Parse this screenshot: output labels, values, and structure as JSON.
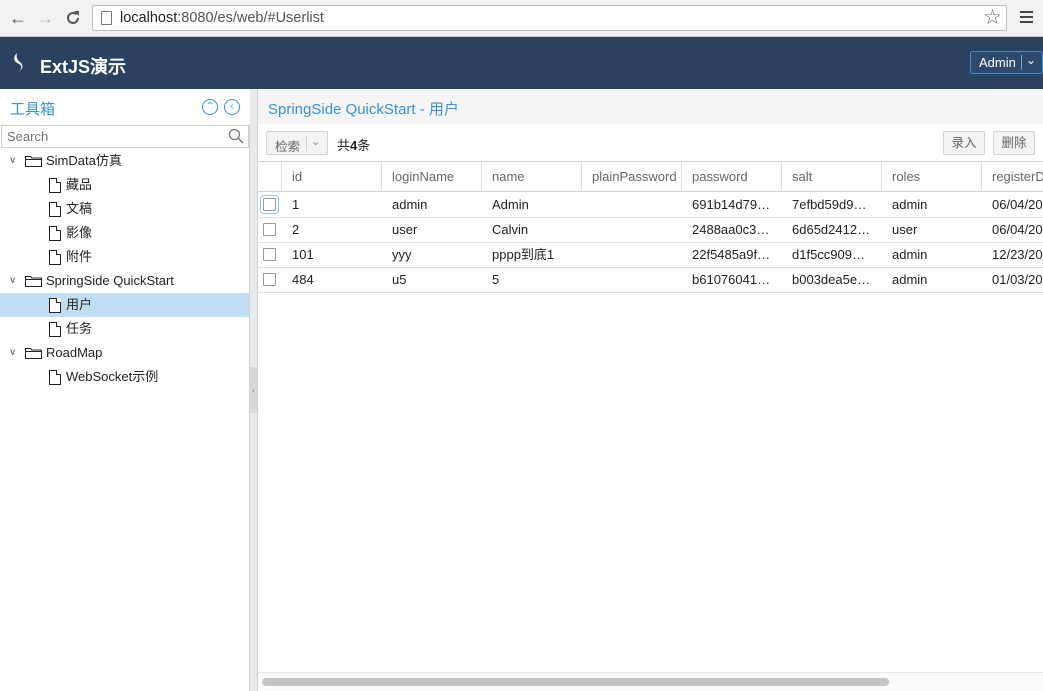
{
  "browser": {
    "url_host": "localhost",
    "url_rest": ":8080/es/web/#Userlist",
    "back_icon": "back-arrow-icon",
    "forward_icon": "forward-arrow-icon",
    "reload_icon": "reload-icon"
  },
  "app": {
    "title": "ExtJS演示",
    "user_menu_label": "Admin",
    "header_color": "#2a4260"
  },
  "west": {
    "title": "工具箱",
    "search_placeholder": "Search",
    "tree": [
      {
        "label": "SimData仿真",
        "type": "folder",
        "expanded": true,
        "children": [
          {
            "label": "藏品"
          },
          {
            "label": "文稿"
          },
          {
            "label": "影像"
          },
          {
            "label": "附件"
          }
        ]
      },
      {
        "label": "SpringSide QuickStart",
        "type": "folder",
        "expanded": true,
        "children": [
          {
            "label": "用户",
            "selected": true
          },
          {
            "label": "任务"
          }
        ]
      },
      {
        "label": "RoadMap",
        "type": "folder",
        "expanded": true,
        "children": [
          {
            "label": "WebSocket示例"
          }
        ]
      }
    ]
  },
  "center": {
    "title": "SpringSide QuickStart - 用户",
    "toolbar": {
      "search_label": "检索",
      "count_prefix": "共",
      "count_value": "4",
      "count_suffix": "条",
      "add_label": "录入",
      "delete_label": "删除"
    },
    "grid": {
      "columns": [
        "id",
        "loginName",
        "name",
        "plainPassword",
        "password",
        "salt",
        "roles",
        "registerD"
      ],
      "rows": [
        [
          "1",
          "admin",
          "Admin",
          "",
          "691b14d79…",
          "7efbd59d9…",
          "admin",
          "06/04/20"
        ],
        [
          "2",
          "user",
          "Calvin",
          "",
          "2488aa0c3…",
          "6d65d2412…",
          "user",
          "06/04/20"
        ],
        [
          "101",
          "yyy",
          "pppp到底1",
          "",
          "22f5485a9f…",
          "d1f5cc909…",
          "admin",
          "12/23/20"
        ],
        [
          "484",
          "u5",
          "5",
          "",
          "b61076041…",
          "b003dea5e…",
          "admin",
          "01/03/20"
        ]
      ]
    }
  },
  "colors": {
    "accent": "#3892d4",
    "selected_row": "#c1ddf1"
  }
}
